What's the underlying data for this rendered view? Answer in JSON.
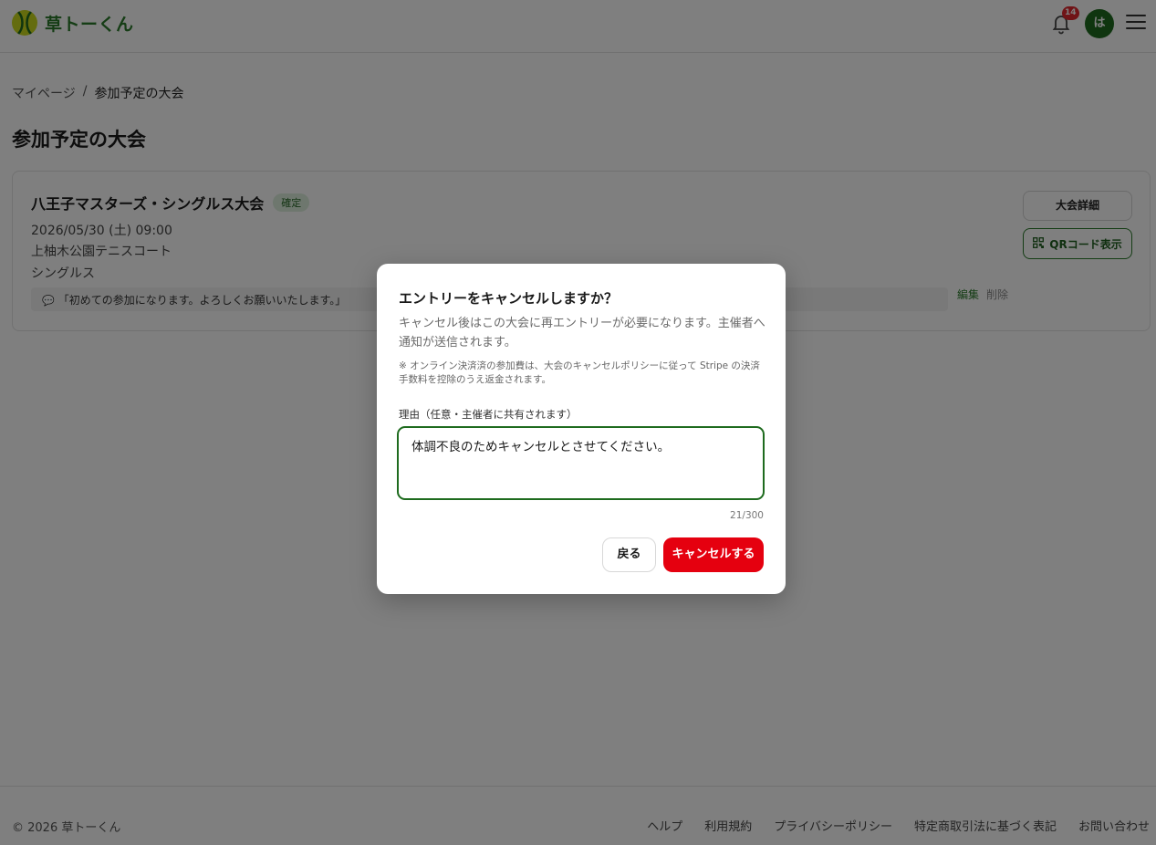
{
  "header": {
    "logo_text": "草トーくん",
    "notification_count": "14",
    "avatar_initial": "は"
  },
  "breadcrumb": {
    "home": "マイページ",
    "separator": "/",
    "current": "参加予定の大会"
  },
  "page_title": "参加予定の大会",
  "card": {
    "title": "八王子マスターズ・シングルス大会",
    "status": "確定",
    "datetime": "2026/05/30 (土) 09:00",
    "venue": "上柚木公園テニスコート",
    "format": "シングルス",
    "comment": "「初めての参加になります。よろしくお願いいたします。」",
    "edit_label": "編集",
    "delete_label": "削除",
    "detail_button": "大会詳細",
    "qr_button": "QRコード表示"
  },
  "footer": {
    "copyright": "© 2026 草トーくん",
    "links": [
      "ヘルプ",
      "利用規約",
      "プライバシーポリシー",
      "特定商取引法に基づく表記",
      "お問い合わせ"
    ]
  },
  "modal": {
    "title": "エントリーをキャンセルしますか？",
    "description": "キャンセル後はこの大会に再エントリーが必要になります。主催者へ通知が送信されます。",
    "note": "※ オンライン決済済の参加費は、大会のキャンセルポリシーに従って Stripe の決済手数料を控除のうえ返金されます。",
    "reason_label": "理由（任意・主催者に共有されます）",
    "reason_value": "体調不良のためキャンセルとさせてください。",
    "char_count": "21/300",
    "back_button": "戻る",
    "cancel_button": "キャンセルする"
  },
  "colors": {
    "brand_green": "#1e6b1e",
    "danger_red": "#e5000f",
    "badge_red": "#e0282e"
  }
}
